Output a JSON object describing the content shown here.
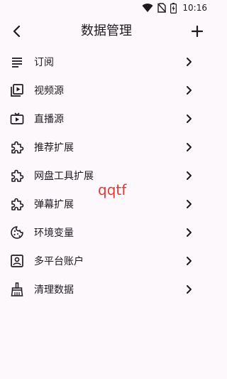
{
  "status_bar": {
    "time": "10:16",
    "icons": [
      "wifi-icon",
      "no-sim-icon",
      "battery-charging-icon"
    ]
  },
  "app_bar": {
    "title": "数据管理",
    "back_icon": "back-arrow-icon",
    "add_icon": "add-icon"
  },
  "menu": {
    "items": [
      {
        "label": "订阅",
        "icon": "subscription-list-icon"
      },
      {
        "label": "视频源",
        "icon": "video-library-icon"
      },
      {
        "label": "直播源",
        "icon": "live-tv-icon"
      },
      {
        "label": "推荐扩展",
        "icon": "extension-icon"
      },
      {
        "label": "网盘工具扩展",
        "icon": "extension-icon"
      },
      {
        "label": "弹幕扩展",
        "icon": "extension-icon"
      },
      {
        "label": "环境变量",
        "icon": "cookie-icon"
      },
      {
        "label": "多平台账户",
        "icon": "account-box-icon"
      },
      {
        "label": "清理数据",
        "icon": "cleaning-broom-icon"
      }
    ],
    "chevron_icon": "chevron-right-icon"
  },
  "watermark": "qqtf"
}
